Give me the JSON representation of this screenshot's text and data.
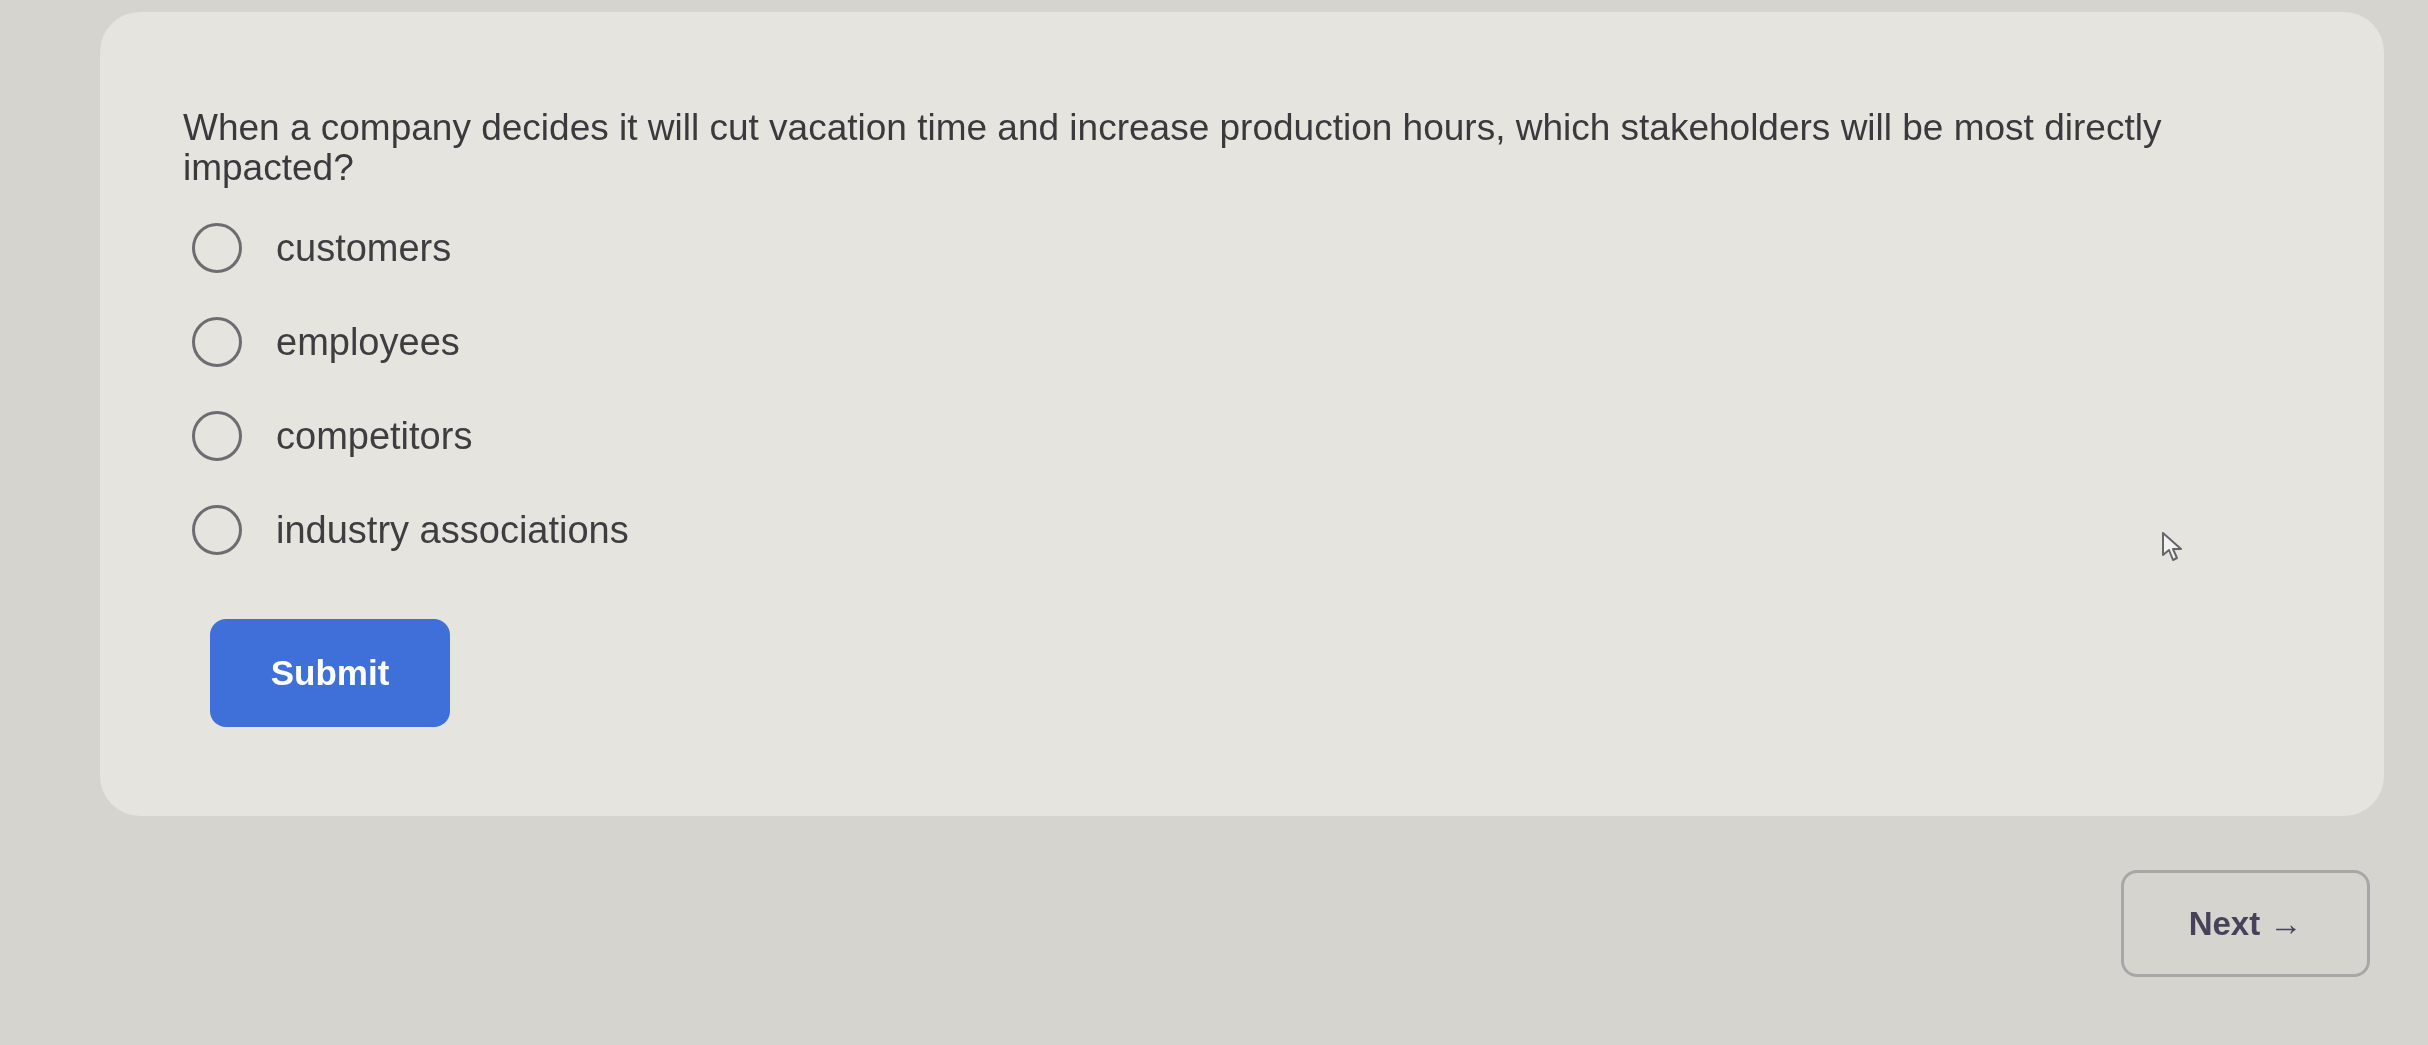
{
  "question": {
    "text": "When a company decides it will cut vacation time and increase production hours, which stakeholders will be most directly impacted?"
  },
  "options": [
    {
      "label": "customers",
      "selected": false
    },
    {
      "label": "employees",
      "selected": false
    },
    {
      "label": "competitors",
      "selected": false
    },
    {
      "label": "industry associations",
      "selected": false
    }
  ],
  "submit_button": {
    "label": "Submit"
  },
  "next_button": {
    "label": "Next →"
  }
}
